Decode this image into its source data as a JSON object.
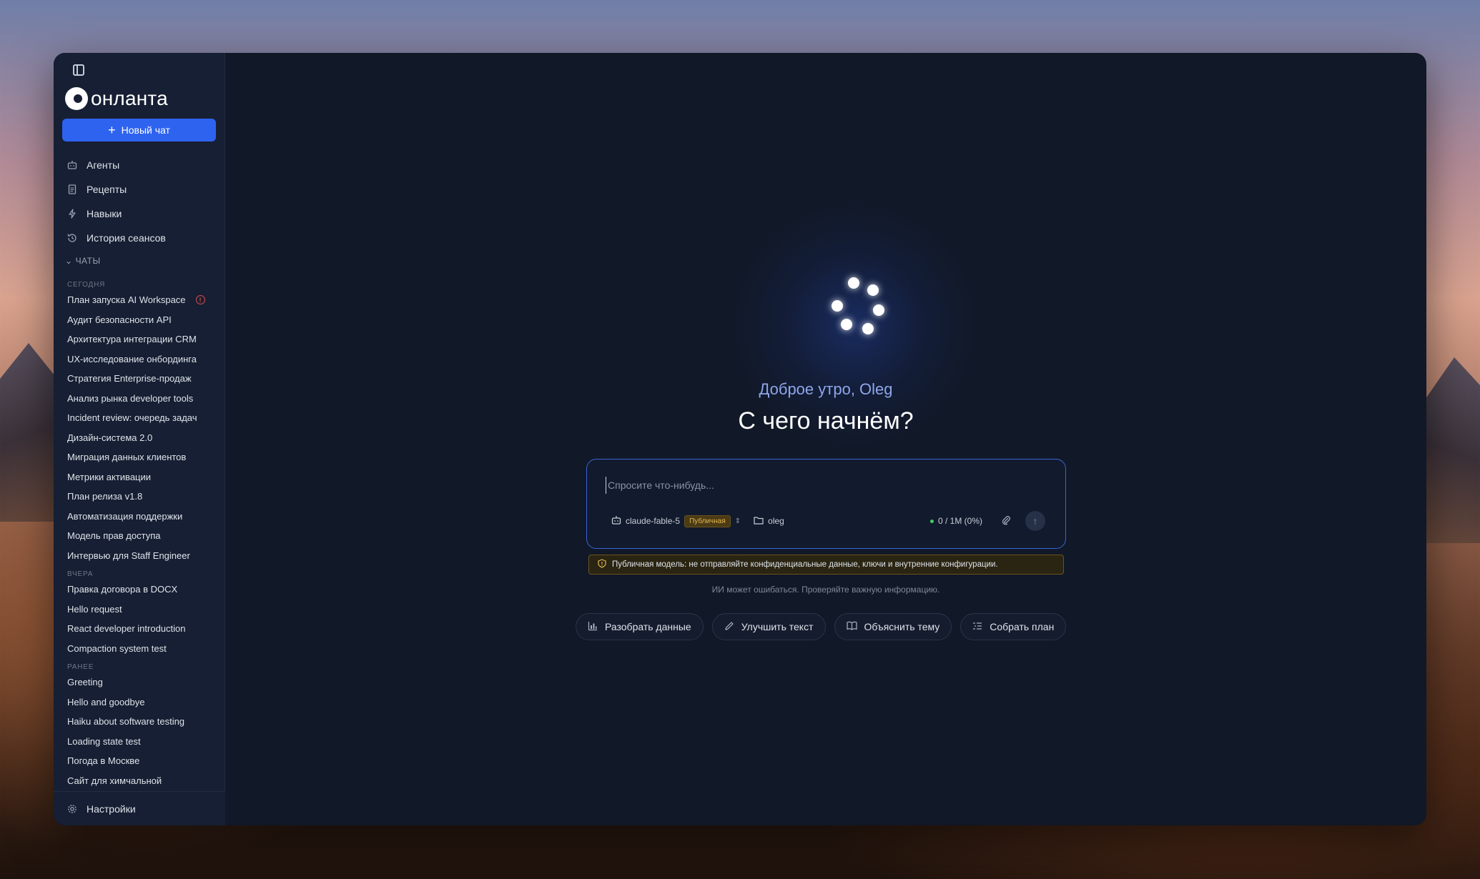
{
  "app": {
    "name": "онланта"
  },
  "sidebar": {
    "new_chat_label": "Новый чат",
    "nav": [
      {
        "label": "Агенты",
        "icon": "robot-icon"
      },
      {
        "label": "Рецепты",
        "icon": "document-icon"
      },
      {
        "label": "Навыки",
        "icon": "lightning-icon"
      },
      {
        "label": "История сеансов",
        "icon": "history-icon"
      }
    ],
    "chats_section": "ЧАТЫ",
    "groups": {
      "today": {
        "label": "СЕГОДНЯ",
        "items": [
          "План запуска AI Workspace",
          "Аудит безопасности API",
          "Архитектура интеграции CRM",
          "UX-исследование онбординга",
          "Стратегия Enterprise-продаж",
          "Анализ рынка developer tools",
          "Incident review: очередь задач",
          "Дизайн-система 2.0",
          "Миграция данных клиентов",
          "Метрики активации",
          "План релиза v1.8",
          "Автоматизация поддержки",
          "Модель прав доступа",
          "Интервью для Staff Engineer"
        ]
      },
      "yesterday": {
        "label": "ВЧЕРА",
        "items": [
          "Правка договора в DOCX",
          "Hello request",
          "React developer introduction",
          "Compaction system test"
        ]
      },
      "earlier": {
        "label": "РАНЕЕ",
        "items": [
          "Greeting",
          "Hello and goodbye",
          "Haiku about software testing",
          "Loading state test",
          "Погода в Москве",
          "Сайт для химчальной"
        ]
      }
    },
    "settings_label": "Настройки"
  },
  "main": {
    "greeting": "Доброе утро, Oleg",
    "headline": "С чего начнём?",
    "composer": {
      "placeholder": "Спросите что-нибудь...",
      "model": "claude-fable-5",
      "model_badge": "Публичная",
      "folder": "oleg",
      "usage": "0 / 1M (0%)"
    },
    "warning": "Публичная модель: не отправляйте конфиденциальные данные, ключи и внутренние конфигурации.",
    "disclaimer": "ИИ может ошибаться. Проверяйте важную информацию.",
    "actions": [
      {
        "label": "Разобрать данные",
        "icon": "chart-icon"
      },
      {
        "label": "Улучшить текст",
        "icon": "pencil-icon"
      },
      {
        "label": "Объяснить тему",
        "icon": "book-icon"
      },
      {
        "label": "Собрать план",
        "icon": "list-icon"
      }
    ]
  },
  "colors": {
    "accent": "#2e63f0",
    "sidebar_bg": "#161f33",
    "main_bg": "#111827",
    "warning": "#e3b84f",
    "error": "#e04b4b",
    "status_ok": "#3ecf6a"
  }
}
